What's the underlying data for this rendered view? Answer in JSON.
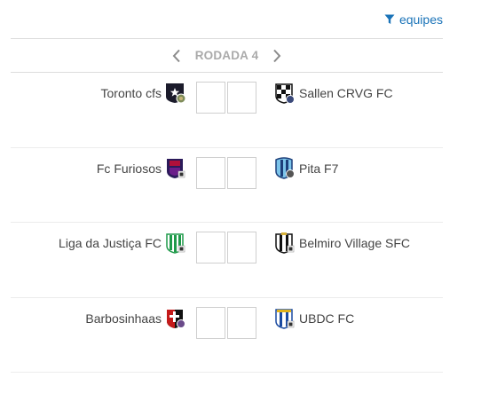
{
  "header": {
    "filter_label": "equipes",
    "filter_icon": "filter-icon"
  },
  "round": {
    "title": "RODADA 4",
    "prev_icon": "chevron-left-icon",
    "next_icon": "chevron-right-icon"
  },
  "matches": [
    {
      "home": "Toronto cfs",
      "away": "Sallen CRVG FC",
      "home_score": "",
      "away_score": ""
    },
    {
      "home": "Fc Furiosos",
      "away": "Pita F7",
      "home_score": "",
      "away_score": ""
    },
    {
      "home": "Liga da Justiça FC",
      "away": "Belmiro Village SFC",
      "home_score": "",
      "away_score": ""
    },
    {
      "home": "Barbosinhaas",
      "away": "UBDC FC",
      "home_score": "",
      "away_score": ""
    }
  ],
  "colors": {
    "accent": "#1a73b8",
    "round_title": "#aaaaaa",
    "divider": "#dcdcdc"
  }
}
